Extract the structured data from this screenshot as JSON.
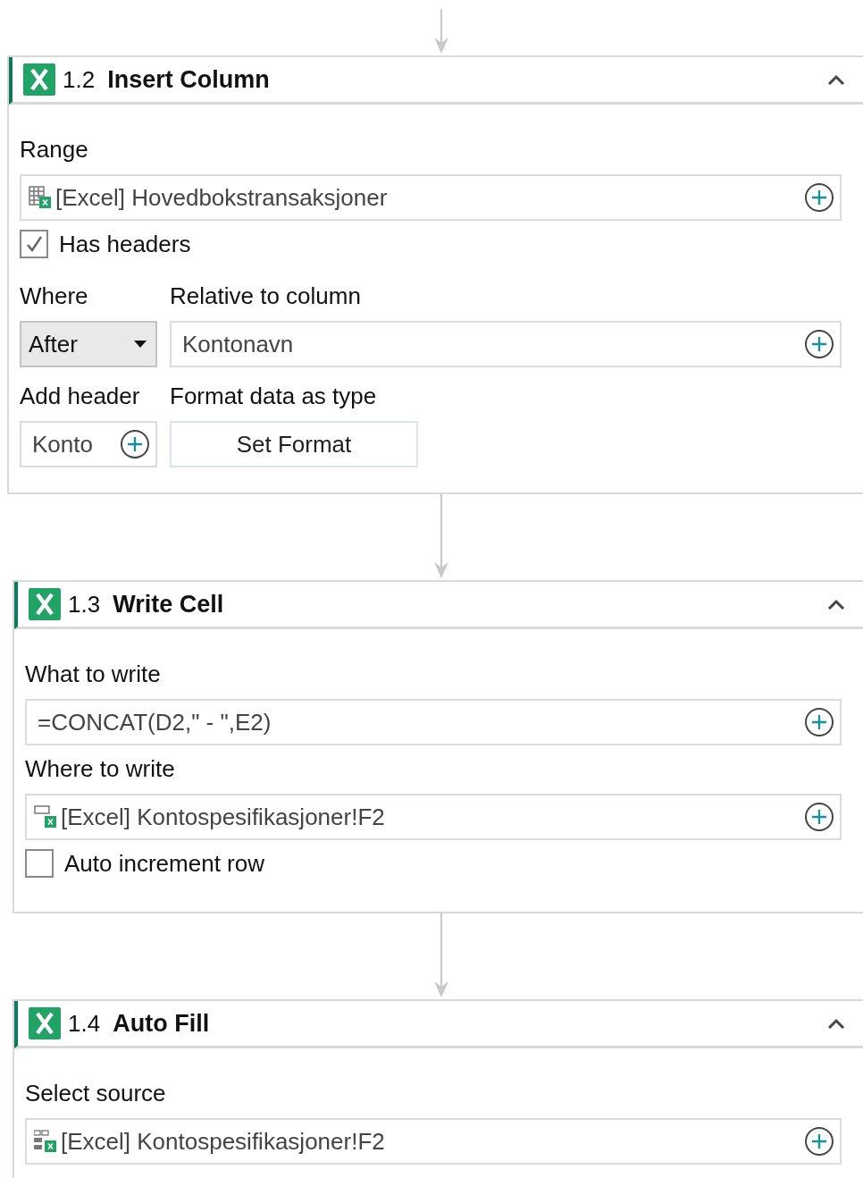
{
  "steps": [
    {
      "number": "1.2",
      "title": "Insert Column",
      "expanded": true,
      "rows": [
        {
          "kind": "label",
          "text": "Range"
        },
        {
          "kind": "table_ref",
          "value": "[Excel] Hovedbokstransaksjoner"
        },
        {
          "kind": "checkbox",
          "label": "Has headers",
          "checked": true
        },
        {
          "kind": "pair",
          "cells": [
            {
              "kind": "label",
              "text": "Where"
            },
            {
              "kind": "label",
              "text": "Relative to column"
            }
          ]
        },
        {
          "kind": "pair",
          "cells": [
            {
              "kind": "dropdown",
              "value": "After"
            },
            {
              "kind": "field",
              "value": "Kontonavn"
            }
          ]
        },
        {
          "kind": "pair",
          "cells": [
            {
              "kind": "label",
              "text": "Add header"
            },
            {
              "kind": "label",
              "text": "Format data as type"
            }
          ]
        },
        {
          "kind": "pair",
          "cells": [
            {
              "kind": "field",
              "value": "Konto"
            },
            {
              "kind": "button",
              "text": "Set Format"
            }
          ]
        }
      ]
    },
    {
      "number": "1.3",
      "title": "Write Cell",
      "expanded": true,
      "rows": [
        {
          "kind": "label",
          "text": "What to write"
        },
        {
          "kind": "field",
          "value": "=CONCAT(D2,\" - \",E2)"
        },
        {
          "kind": "label",
          "text": "Where to write"
        },
        {
          "kind": "cell_ref",
          "value": "[Excel] Kontospesifikasjoner!F2"
        },
        {
          "kind": "checkbox",
          "label": "Auto increment row",
          "checked": false
        }
      ]
    },
    {
      "number": "1.4",
      "title": "Auto Fill",
      "expanded": true,
      "rows": [
        {
          "kind": "label",
          "text": "Select source"
        },
        {
          "kind": "range_ref",
          "value": "[Excel] Kontospesifikasjoner!F2"
        }
      ]
    }
  ]
}
